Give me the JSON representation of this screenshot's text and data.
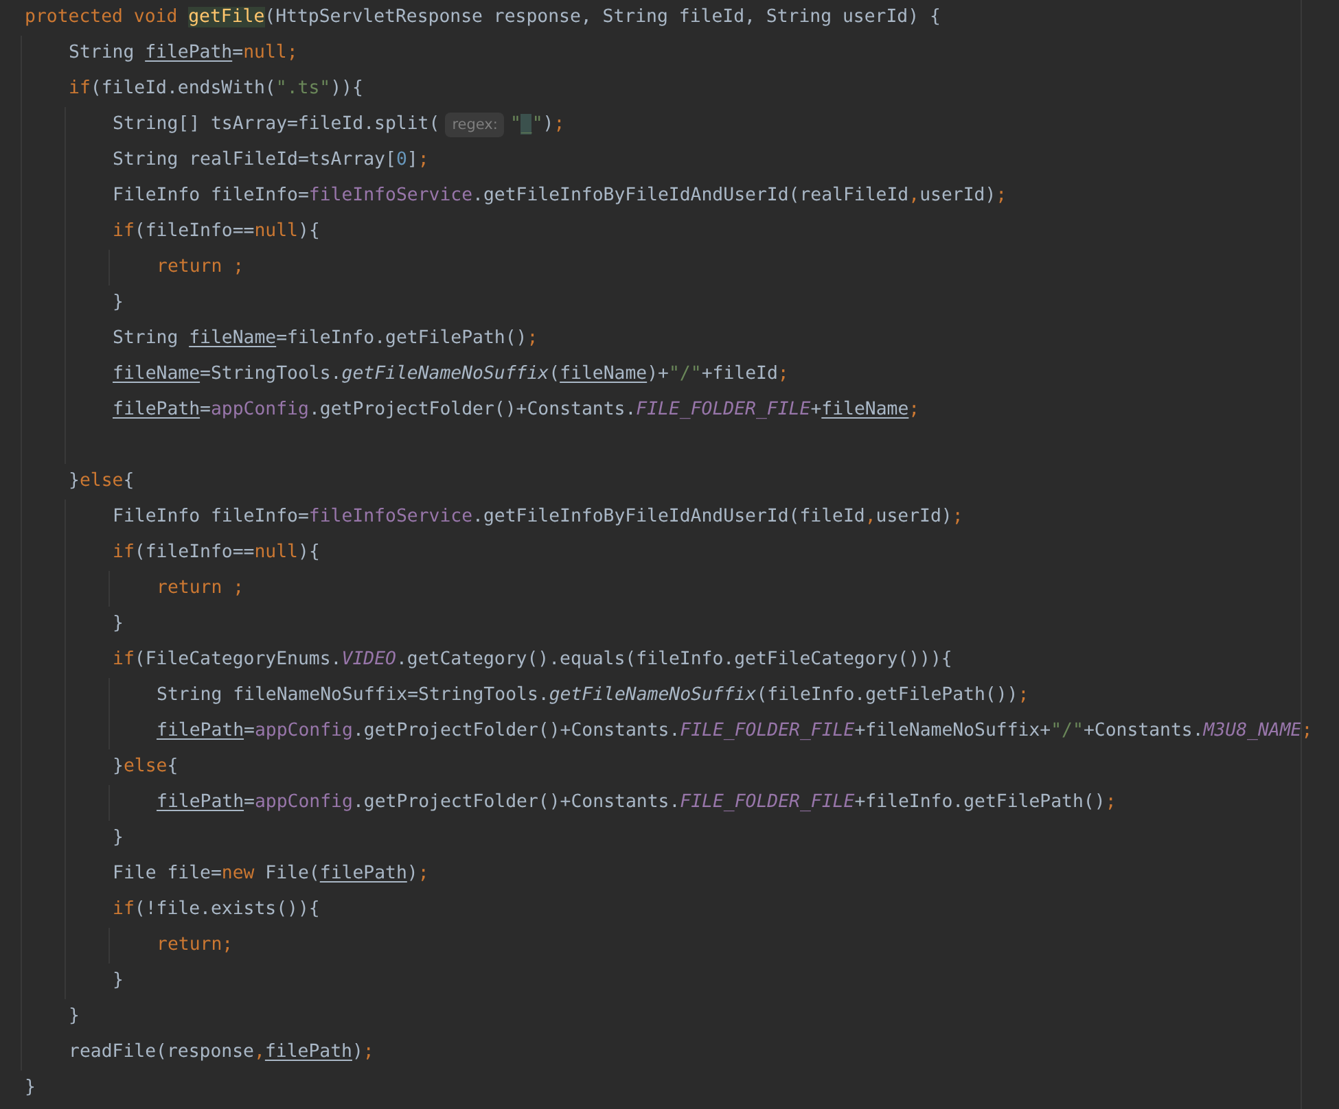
{
  "editor": {
    "lines": [
      {
        "kind": "code",
        "tokens": [
          {
            "text": "protected void ",
            "kind": "keyword"
          },
          {
            "text": "getFile",
            "kind": "declaration"
          },
          {
            "text": "(HttpServletResponse response, String fileId, String userId) {",
            "kind": "plain"
          }
        ],
        "children": [
          {
            "kind": "code",
            "tokens": [
              {
                "text": "String ",
                "kind": "plain"
              },
              {
                "text": "filePath",
                "kind": "reassigned"
              },
              {
                "text": "=",
                "kind": "plain"
              },
              {
                "text": "null",
                "kind": "keyword"
              },
              {
                "text": ";",
                "kind": "punct"
              }
            ]
          },
          {
            "kind": "code",
            "tokens": [
              {
                "text": "if",
                "kind": "keyword"
              },
              {
                "text": "(fileId.endsWith(",
                "kind": "plain"
              },
              {
                "text": "\".ts\"",
                "kind": "string"
              },
              {
                "text": ")){",
                "kind": "plain"
              }
            ],
            "children": [
              {
                "kind": "code",
                "tokens": [
                  {
                    "text": "String[] tsArray=fileId.split(",
                    "kind": "plain"
                  },
                  {
                    "text": "regex:",
                    "kind": "hint"
                  },
                  {
                    "text": "\"",
                    "kind": "string"
                  },
                  {
                    "text": "_",
                    "kind": "string-match"
                  },
                  {
                    "text": "\"",
                    "kind": "string"
                  },
                  {
                    "text": ")",
                    "kind": "plain"
                  },
                  {
                    "text": ";",
                    "kind": "punct"
                  }
                ]
              },
              {
                "kind": "code",
                "tokens": [
                  {
                    "text": "String realFileId=tsArray[",
                    "kind": "plain"
                  },
                  {
                    "text": "0",
                    "kind": "number"
                  },
                  {
                    "text": "]",
                    "kind": "plain"
                  },
                  {
                    "text": ";",
                    "kind": "punct"
                  }
                ]
              },
              {
                "kind": "code",
                "tokens": [
                  {
                    "text": "FileInfo fileInfo=",
                    "kind": "plain"
                  },
                  {
                    "text": "fileInfoService",
                    "kind": "field"
                  },
                  {
                    "text": ".getFileInfoByFileIdAndUserId(realFileId",
                    "kind": "plain"
                  },
                  {
                    "text": ",",
                    "kind": "punct"
                  },
                  {
                    "text": "userId)",
                    "kind": "plain"
                  },
                  {
                    "text": ";",
                    "kind": "punct"
                  }
                ]
              },
              {
                "kind": "code",
                "tokens": [
                  {
                    "text": "if",
                    "kind": "keyword"
                  },
                  {
                    "text": "(fileInfo==",
                    "kind": "plain"
                  },
                  {
                    "text": "null",
                    "kind": "keyword"
                  },
                  {
                    "text": "){",
                    "kind": "plain"
                  }
                ],
                "children": [
                  {
                    "kind": "code",
                    "tokens": [
                      {
                        "text": "return ;",
                        "kind": "keyword"
                      }
                    ]
                  }
                ]
              },
              {
                "kind": "code",
                "tokens": [
                  {
                    "text": "}",
                    "kind": "plain"
                  }
                ]
              },
              {
                "kind": "code",
                "tokens": [
                  {
                    "text": "String ",
                    "kind": "plain"
                  },
                  {
                    "text": "fileName",
                    "kind": "reassigned"
                  },
                  {
                    "text": "=fileInfo.getFilePath()",
                    "kind": "plain"
                  },
                  {
                    "text": ";",
                    "kind": "punct"
                  }
                ]
              },
              {
                "kind": "code",
                "tokens": [
                  {
                    "text": "fileName",
                    "kind": "reassigned"
                  },
                  {
                    "text": "=StringTools.",
                    "kind": "plain"
                  },
                  {
                    "text": "getFileNameNoSuffix",
                    "kind": "static-method"
                  },
                  {
                    "text": "(",
                    "kind": "plain"
                  },
                  {
                    "text": "fileName",
                    "kind": "reassigned"
                  },
                  {
                    "text": ")+",
                    "kind": "plain"
                  },
                  {
                    "text": "\"/\"",
                    "kind": "string"
                  },
                  {
                    "text": "+fileId",
                    "kind": "plain"
                  },
                  {
                    "text": ";",
                    "kind": "punct"
                  }
                ]
              },
              {
                "kind": "code",
                "tokens": [
                  {
                    "text": "filePath",
                    "kind": "reassigned"
                  },
                  {
                    "text": "=",
                    "kind": "plain"
                  },
                  {
                    "text": "appConfig",
                    "kind": "field"
                  },
                  {
                    "text": ".getProjectFolder()+Constants.",
                    "kind": "plain"
                  },
                  {
                    "text": "FILE_FOLDER_FILE",
                    "kind": "constant"
                  },
                  {
                    "text": "+",
                    "kind": "plain"
                  },
                  {
                    "text": "fileName",
                    "kind": "reassigned"
                  },
                  {
                    "text": ";",
                    "kind": "punct"
                  }
                ]
              },
              {
                "kind": "blank"
              }
            ]
          },
          {
            "kind": "code",
            "tokens": [
              {
                "text": "}",
                "kind": "plain"
              },
              {
                "text": "else",
                "kind": "keyword"
              },
              {
                "text": "{",
                "kind": "plain"
              }
            ],
            "children": [
              {
                "kind": "code",
                "tokens": [
                  {
                    "text": "FileInfo fileInfo=",
                    "kind": "plain"
                  },
                  {
                    "text": "fileInfoService",
                    "kind": "field"
                  },
                  {
                    "text": ".getFileInfoByFileIdAndUserId(fileId",
                    "kind": "plain"
                  },
                  {
                    "text": ",",
                    "kind": "punct"
                  },
                  {
                    "text": "userId)",
                    "kind": "plain"
                  },
                  {
                    "text": ";",
                    "kind": "punct"
                  }
                ]
              },
              {
                "kind": "code",
                "tokens": [
                  {
                    "text": "if",
                    "kind": "keyword"
                  },
                  {
                    "text": "(fileInfo==",
                    "kind": "plain"
                  },
                  {
                    "text": "null",
                    "kind": "keyword"
                  },
                  {
                    "text": "){",
                    "kind": "plain"
                  }
                ],
                "children": [
                  {
                    "kind": "code",
                    "tokens": [
                      {
                        "text": "return ;",
                        "kind": "keyword"
                      }
                    ]
                  }
                ]
              },
              {
                "kind": "code",
                "tokens": [
                  {
                    "text": "}",
                    "kind": "plain"
                  }
                ]
              },
              {
                "kind": "code",
                "tokens": [
                  {
                    "text": "if",
                    "kind": "keyword"
                  },
                  {
                    "text": "(FileCategoryEnums.",
                    "kind": "plain"
                  },
                  {
                    "text": "VIDEO",
                    "kind": "constant"
                  },
                  {
                    "text": ".getCategory().equals(fileInfo.getFileCategory())){",
                    "kind": "plain"
                  }
                ],
                "children": [
                  {
                    "kind": "code",
                    "tokens": [
                      {
                        "text": "String fileNameNoSuffix=StringTools.",
                        "kind": "plain"
                      },
                      {
                        "text": "getFileNameNoSuffix",
                        "kind": "static-method"
                      },
                      {
                        "text": "(fileInfo.getFilePath())",
                        "kind": "plain"
                      },
                      {
                        "text": ";",
                        "kind": "punct"
                      }
                    ]
                  },
                  {
                    "kind": "code",
                    "tokens": [
                      {
                        "text": "filePath",
                        "kind": "reassigned"
                      },
                      {
                        "text": "=",
                        "kind": "plain"
                      },
                      {
                        "text": "appConfig",
                        "kind": "field"
                      },
                      {
                        "text": ".getProjectFolder()+Constants.",
                        "kind": "plain"
                      },
                      {
                        "text": "FILE_FOLDER_FILE",
                        "kind": "constant"
                      },
                      {
                        "text": "+fileNameNoSuffix+",
                        "kind": "plain"
                      },
                      {
                        "text": "\"/\"",
                        "kind": "string"
                      },
                      {
                        "text": "+Constants.",
                        "kind": "plain"
                      },
                      {
                        "text": "M3U8_NAME",
                        "kind": "constant"
                      },
                      {
                        "text": ";",
                        "kind": "punct"
                      }
                    ]
                  }
                ]
              },
              {
                "kind": "code",
                "tokens": [
                  {
                    "text": "}",
                    "kind": "plain"
                  },
                  {
                    "text": "else",
                    "kind": "keyword"
                  },
                  {
                    "text": "{",
                    "kind": "plain"
                  }
                ],
                "children": [
                  {
                    "kind": "code",
                    "tokens": [
                      {
                        "text": "filePath",
                        "kind": "reassigned"
                      },
                      {
                        "text": "=",
                        "kind": "plain"
                      },
                      {
                        "text": "appConfig",
                        "kind": "field"
                      },
                      {
                        "text": ".getProjectFolder()+Constants.",
                        "kind": "plain"
                      },
                      {
                        "text": "FILE_FOLDER_FILE",
                        "kind": "constant"
                      },
                      {
                        "text": "+fileInfo.getFilePath()",
                        "kind": "plain"
                      },
                      {
                        "text": ";",
                        "kind": "punct"
                      }
                    ]
                  }
                ]
              },
              {
                "kind": "code",
                "tokens": [
                  {
                    "text": "}",
                    "kind": "plain"
                  }
                ]
              },
              {
                "kind": "code",
                "tokens": [
                  {
                    "text": "File file=",
                    "kind": "plain"
                  },
                  {
                    "text": "new",
                    "kind": "keyword"
                  },
                  {
                    "text": " File(",
                    "kind": "plain"
                  },
                  {
                    "text": "filePath",
                    "kind": "reassigned"
                  },
                  {
                    "text": ")",
                    "kind": "plain"
                  },
                  {
                    "text": ";",
                    "kind": "punct"
                  }
                ]
              },
              {
                "kind": "code",
                "tokens": [
                  {
                    "text": "if",
                    "kind": "keyword"
                  },
                  {
                    "text": "(!file.exists()){",
                    "kind": "plain"
                  }
                ],
                "children": [
                  {
                    "kind": "code",
                    "tokens": [
                      {
                        "text": "return;",
                        "kind": "keyword"
                      }
                    ]
                  }
                ]
              },
              {
                "kind": "code",
                "tokens": [
                  {
                    "text": "}",
                    "kind": "plain"
                  }
                ]
              }
            ]
          },
          {
            "kind": "code",
            "tokens": [
              {
                "text": "}",
                "kind": "plain"
              }
            ]
          },
          {
            "kind": "code",
            "tokens": [
              {
                "text": "readFile(response",
                "kind": "plain"
              },
              {
                "text": ",",
                "kind": "punct"
              },
              {
                "text": "filePath",
                "kind": "reassigned"
              },
              {
                "text": ")",
                "kind": "plain"
              },
              {
                "text": ";",
                "kind": "punct"
              }
            ]
          }
        ]
      },
      {
        "kind": "code",
        "tokens": [
          {
            "text": "}",
            "kind": "plain"
          }
        ]
      }
    ]
  }
}
